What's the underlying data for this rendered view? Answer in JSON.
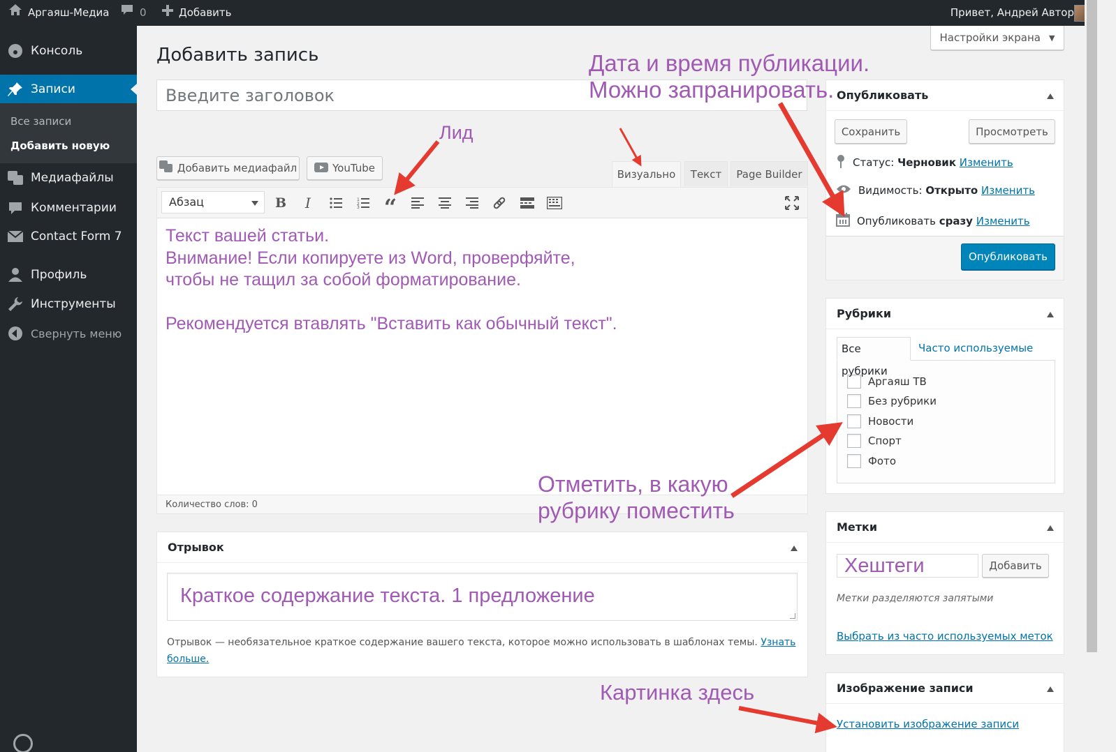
{
  "adminbar": {
    "site_name": "Аргаяш-Медиа",
    "comments_count": "0",
    "add_label": "Добавить",
    "greeting": "Привет, Андрей Автор"
  },
  "sidebar": {
    "items": [
      {
        "label": "Консоль",
        "icon": "dashboard-icon"
      },
      {
        "label": "Записи",
        "icon": "pin-icon"
      },
      {
        "label": "Медиафайлы",
        "icon": "media-icon"
      },
      {
        "label": "Комментарии",
        "icon": "comment-icon"
      },
      {
        "label": "Contact Form 7",
        "icon": "mail-icon"
      },
      {
        "label": "Профиль",
        "icon": "user-icon"
      },
      {
        "label": "Инструменты",
        "icon": "wrench-icon"
      },
      {
        "label": "Свернуть меню",
        "icon": "collapse-icon"
      }
    ],
    "submenu": [
      "Все записи",
      "Добавить новую"
    ]
  },
  "screen_options": "Настройки экрана",
  "page_title": "Добавить запись",
  "title_placeholder": "Введите заголовок",
  "media_buttons": {
    "add_media": "Добавить медиафайл",
    "youtube": "YouTube"
  },
  "editor_tabs": [
    "Визуально",
    "Текст",
    "Page Builder"
  ],
  "format_select": "Абзац",
  "content_lines": [
    "Текст вашей статьи.",
    "Внимание! Если копируете из Word, проверфяйте,",
    "чтобы не тащил за собой форматирование.",
    "Рекомендуется втавлять \"Вставить как обычный текст\"."
  ],
  "word_count": "Количество слов: 0",
  "excerpt": {
    "title": "Отрывок",
    "value": "Краткое содержание текста. 1 предложение",
    "help": "Отрывок — необязательное краткое содержание вашего текста, которое можно использовать в шаблонах темы.",
    "help_link": "Узнать больше."
  },
  "publish": {
    "title": "Опубликовать",
    "save": "Сохранить",
    "preview": "Просмотреть",
    "status_label": "Статус:",
    "status_value": "Черновик",
    "visibility_label": "Видимость:",
    "visibility_value": "Открыто",
    "schedule_label": "Опубликовать",
    "schedule_value": "сразу",
    "edit": "Изменить",
    "publish_button": "Опубликовать"
  },
  "categories": {
    "title": "Рубрики",
    "tab_all": "Все рубрики",
    "tab_popular": "Часто используемые",
    "items": [
      "Аргаяш ТВ",
      "Без рубрики",
      "Новости",
      "Спорт",
      "Фото"
    ]
  },
  "tags": {
    "title": "Метки",
    "input_value": "Хештеги",
    "add_button": "Добавить",
    "hint": "Метки разделяются запятыми",
    "choose_link": "Выбрать из часто используемых меток"
  },
  "featured_image": {
    "title": "Изображение записи",
    "set_link": "Установить изображение записи"
  },
  "annotations": {
    "lead": "Лид",
    "date_line1": "Дата и время публикации.",
    "date_line2": "Можно запранировать.",
    "category_line1": "Отметить, в какую",
    "category_line2": "рубрику поместить",
    "image": "Картинка здесь"
  },
  "colors": {
    "annotation": "#a05ab4",
    "arrow": "#e53a2f",
    "admin_dark": "#23282d",
    "accent": "#0073aa",
    "primary_button": "#0085ba"
  }
}
